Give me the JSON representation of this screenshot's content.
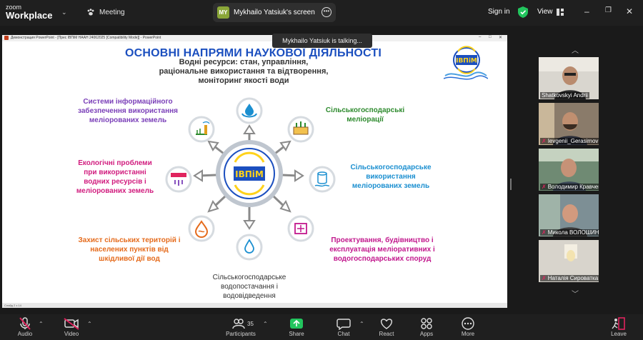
{
  "topbar": {
    "brand_line1": "zoom",
    "brand_line2": "Workplace",
    "meeting_label": "Meeting",
    "screen_avatar": "MY",
    "screen_label": "Mykhailo Yatsiuk's screen",
    "signin_label": "Sign in",
    "view_label": "View"
  },
  "talking_toast": "Mykhailo Yatsiuk is talking...",
  "ppt": {
    "window_title": "Демонстрация PowerPoint - [Прес ІВПіМ НААН 24062025 [Compatibility Mode]] - PowerPoint",
    "status": "Слайд 2 з 14"
  },
  "slide": {
    "title": "ОСНОВНІ НАПРЯМИ НАУКОВОЇ ДІЯЛЬНОСТІ",
    "center_title": "Водні ресурси: стан, управління, раціональне використання та відтворення, моніторинг якості води",
    "logo_text": "ІВПіМ",
    "hub_text": "ІВПіМ",
    "items": {
      "info_systems": "Системи інформаційного забезпечення використання меліорованих земель",
      "agri_melioration": "Сільськогосподарські меліорації",
      "eco_problems": "Екологічні проблеми при використанні водних ресурсів і меліорованих земель",
      "agri_use": "Сільськогосподарське використання меліорованих земель",
      "protection": "Захист сільських територій і населених пунктів від шкідливої дії вод",
      "design": "Проектування, будівництво і експлуатація меліоративних і водогосподарських споруд",
      "water_supply": "Сільськогосподарське водопостачання і водовідведення"
    }
  },
  "participants_panel": {
    "tiles": [
      {
        "name": "Shatkovskyi Andrii",
        "muted": false
      },
      {
        "name": "Ievgenii_Gerasimov",
        "muted": true
      },
      {
        "name": "Володимир Кравченко",
        "muted": true
      },
      {
        "name": "Микола ВОЛОШИН",
        "muted": true
      },
      {
        "name": "Наталія Сироватка",
        "muted": true
      }
    ]
  },
  "toolbar": {
    "audio": "Audio",
    "video": "Video",
    "participants": "Participants",
    "participants_count": "35",
    "share": "Share",
    "chat": "Chat",
    "react": "React",
    "apps": "Apps",
    "more": "More",
    "leave": "Leave"
  },
  "colors": {
    "title_blue": "#1b4fbf",
    "share_green": "#22c55e",
    "muted_red": "#e0245e"
  }
}
